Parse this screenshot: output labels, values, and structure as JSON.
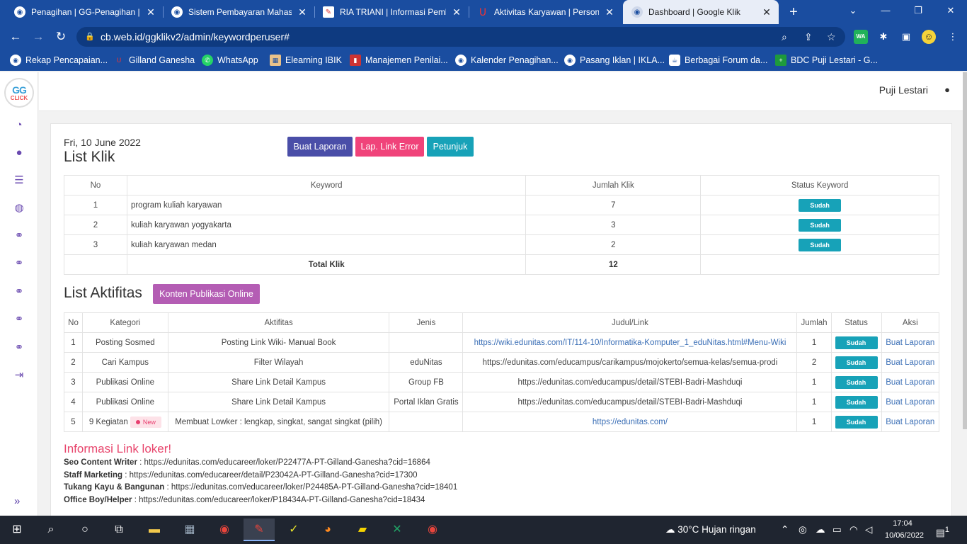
{
  "browser": {
    "tabs": [
      {
        "title": "Penagihan | GG-Penagihan | I",
        "close": "✕"
      },
      {
        "title": "Sistem Pembayaran Mahasisw",
        "close": "✕"
      },
      {
        "title": "RIA TRIANI | Informasi Pemba",
        "close": "✕"
      },
      {
        "title": "Aktivitas Karyawan | Persona",
        "close": "✕"
      },
      {
        "title": "Dashboard | Google Klik",
        "close": "✕"
      }
    ],
    "url": "cb.web.id/ggklikv2/admin/keywordperuser#",
    "bookmarks": [
      "Rekap Pencapaian...",
      "Gilland Ganesha",
      "WhatsApp",
      "Elearning IBIK",
      "Manajemen Penilai...",
      "Kalender Penagihan...",
      "Pasang Iklan | IKLA...",
      "Berbagai Forum da...",
      "BDC Puji Lestari - G..."
    ]
  },
  "app": {
    "logo_top": "GG",
    "logo_bottom": "CLICK",
    "user_name": "Puji Lestari",
    "date": "Fri, 10 June 2022",
    "list_klik_title": "List Klik",
    "buttons": {
      "buat_laporan": "Buat Laporan",
      "lap_link_error": "Lap. Link Error",
      "petunjuk": "Petunjuk",
      "konten_publikasi": "Konten Publikasi Online"
    },
    "colors": {
      "buat_laporan": "#4a4ea8",
      "lap_link_error": "#f0437a",
      "petunjuk": "#17a2b8",
      "konten_publikasi": "#b45db4",
      "status_badge": "#17a2b8",
      "info_title": "#e8456c"
    },
    "klik_table": {
      "headers": [
        "No",
        "Keyword",
        "Jumlah Klik",
        "Status Keyword"
      ],
      "rows": [
        {
          "no": "1",
          "keyword": "program kuliah karyawan",
          "jumlah": "7",
          "status": "Sudah"
        },
        {
          "no": "2",
          "keyword": "kuliah karyawan yogyakarta",
          "jumlah": "3",
          "status": "Sudah"
        },
        {
          "no": "3",
          "keyword": "kuliah karyawan medan",
          "jumlah": "2",
          "status": "Sudah"
        }
      ],
      "total_label": "Total Klik",
      "total_value": "12"
    },
    "list_aktifitas_title": "List Aktifitas",
    "akt_table": {
      "headers": [
        "No",
        "Kategori",
        "Aktifitas",
        "Jenis",
        "Judul/Link",
        "Jumlah",
        "Status",
        "Aksi"
      ],
      "rows": [
        {
          "no": "1",
          "kategori": "Posting Sosmed",
          "aktifitas": "Posting Link Wiki- Manual Book",
          "jenis": "",
          "link": "https://wiki.edunitas.com/IT/114-10/Informatika-Komputer_1_eduNitas.html#Menu-Wiki",
          "jumlah": "1",
          "status": "Sudah",
          "aksi": "Buat Laporan"
        },
        {
          "no": "2",
          "kategori": "Cari Kampus",
          "aktifitas": "Filter Wilayah",
          "jenis": "eduNitas",
          "link": "https://edunitas.com/educampus/carikampus/mojokerto/semua-kelas/semua-prodi",
          "jumlah": "2",
          "status": "Sudah",
          "aksi": "Buat Laporan"
        },
        {
          "no": "3",
          "kategori": "Publikasi Online",
          "aktifitas": "Share Link Detail Kampus",
          "jenis": "Group FB",
          "link": "https://edunitas.com/educampus/detail/STEBI-Badri-Mashduqi",
          "jumlah": "1",
          "status": "Sudah",
          "aksi": "Buat Laporan"
        },
        {
          "no": "4",
          "kategori": "Publikasi Online",
          "aktifitas": "Share Link Detail Kampus",
          "jenis": "Portal Iklan Gratis",
          "link": "https://edunitas.com/educampus/detail/STEBI-Badri-Mashduqi",
          "jumlah": "1",
          "status": "Sudah",
          "aksi": "Buat Laporan"
        },
        {
          "no": "5",
          "kategori": "9 Kegiatan",
          "new_badge": "New",
          "aktifitas": "Membuat Lowker : lengkap, singkat, sangat singkat (pilih)",
          "jenis": "",
          "link": "https://edunitas.com/",
          "jumlah": "1",
          "status": "Sudah",
          "aksi": "Buat Laporan"
        }
      ]
    },
    "info_title": "Informasi Link loker!",
    "info_lines": [
      {
        "label": "Seo Content Writer",
        "sep": " : ",
        "url": "https://edunitas.com/educareer/loker/P22477A-PT-Gilland-Ganesha?cid=16864"
      },
      {
        "label": "Staff Marketing",
        "sep": " : ",
        "url": "https://edunitas.com/educareer/detail/P23042A-PT-Gilland-Ganesha?cid=17300"
      },
      {
        "label": "Tukang Kayu & Bangunan",
        "sep": " : ",
        "url": "https://edunitas.com/educareer/loker/P24485A-PT-Gilland-Ganesha?cid=18401"
      },
      {
        "label": "Office Boy/Helper",
        "sep": " : ",
        "url": "https://edunitas.com/educareer/loker/P18434A-PT-Gilland-Ganesha?cid=18434"
      }
    ]
  },
  "taskbar": {
    "weather": "30°C  Hujan ringan",
    "time": "17:04",
    "date": "10/06/2022",
    "notifications": "1"
  }
}
